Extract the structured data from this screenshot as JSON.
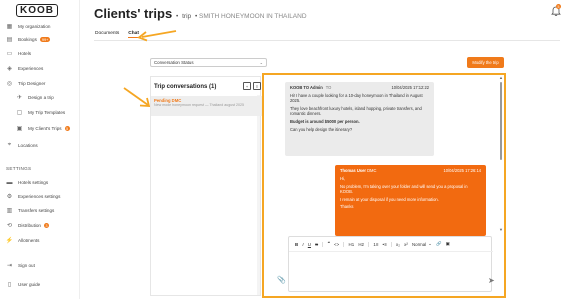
{
  "app": {
    "logo_text": "KOOB"
  },
  "sidebar": {
    "items": [
      {
        "label": "My organization",
        "icon": "organization-icon"
      },
      {
        "label": "Bookings",
        "icon": "bookings-icon",
        "badge": "99+"
      },
      {
        "label": "Hotels",
        "icon": "hotel-icon"
      },
      {
        "label": "Experiences",
        "icon": "experiences-icon"
      },
      {
        "label": "Trip Designer",
        "icon": "trip-designer-icon"
      }
    ],
    "sub_items": [
      {
        "label": "Design a trip",
        "icon": "design-trip-icon"
      },
      {
        "label": "My Trip Templates",
        "icon": "templates-icon"
      },
      {
        "label": "My Client's Trips",
        "icon": "clients-trips-icon",
        "badge": "5"
      }
    ],
    "locations": {
      "label": "Locations",
      "icon": "location-icon"
    },
    "settings_header": "SETTINGS",
    "settings_items": [
      {
        "label": "Hotels settings",
        "icon": "bed-icon"
      },
      {
        "label": "Experiences settings",
        "icon": "experiences-settings-icon"
      },
      {
        "label": "Transfers settings",
        "icon": "bus-icon"
      },
      {
        "label": "Distribution",
        "icon": "distribution-icon",
        "badge": "3"
      },
      {
        "label": "Allotments",
        "icon": "lightning-icon"
      }
    ],
    "sign_out": {
      "label": "Sign out",
      "icon": "sign-out-icon"
    },
    "user_guide": {
      "label": "User guide",
      "icon": "guide-icon"
    }
  },
  "header": {
    "title": "Clients' trips",
    "separator": " • ",
    "section": "trip",
    "trip_name": "SMITH HONEYMOON IN THAILAND",
    "notification_count": "5"
  },
  "tabs": [
    {
      "label": "Documents",
      "active": false
    },
    {
      "label": "Chat",
      "active": true
    }
  ],
  "status_select": {
    "value": "Conversation Status",
    "chevron": "⌄"
  },
  "modify_button": {
    "label": "Modify the trip"
  },
  "conversations": {
    "title": "Trip conversations (1)",
    "items": [
      {
        "status": "Pending DMC",
        "preview": "New mode honeymoon request — Thailand august 2025"
      }
    ]
  },
  "chat": {
    "messages": [
      {
        "sender": "KOOB TO Admin",
        "role": "TO",
        "date": "10/04/2025 17:12:22",
        "paragraphs": [
          "Hi! I have a couple looking for a 10-day honeymoon in Thailand in August 2025.",
          "They love beachfront luxury hotels, island hopping, private transfers, and romantic dinners.",
          "Budget is around $5000 per person.",
          "Can you help design the itinerary?"
        ]
      },
      {
        "sender": "Thomas User",
        "role": "DMC",
        "date": "10/04/2025 17:26:14",
        "paragraphs": [
          "Hi,",
          "No problem, I'm taking over your folder and will send you a proposal in KOOB.",
          "I remain at your disposal if you need more information.",
          "Thanks"
        ]
      }
    ],
    "editor": {
      "format_option": "Normal",
      "toolbar": {
        "bold": "B",
        "italic": "I",
        "underline": "U",
        "strike": "S",
        "quote": "❝",
        "code": "<>",
        "h1": "H1",
        "h2": "H2",
        "ol": "1≡",
        "ul": "•≡",
        "sub": "x₂",
        "sup": "x²",
        "chevron": "⌄",
        "link": "🔗",
        "image": "▣"
      }
    },
    "attach": "📎",
    "send": "➤"
  }
}
